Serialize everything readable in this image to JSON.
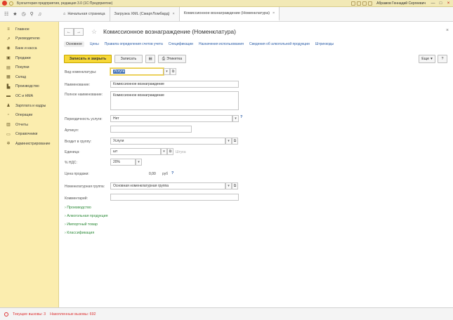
{
  "titlebar": {
    "title": "Бухгалтерия предприятия, редакция 3.0 (1С:Предприятие)",
    "user": "Абрамов Геннадий Сергеевич",
    "window_buttons": [
      "—",
      "□",
      "×"
    ]
  },
  "tabs": [
    {
      "label": "Начальная страница",
      "closable": false
    },
    {
      "label": "Загрузка XML (СмартЛомбард)",
      "closable": true
    },
    {
      "label": "Комиссионное вознаграждение (Номенклатура)",
      "closable": true
    }
  ],
  "sidebar": {
    "items": [
      {
        "label": "Главное",
        "icon": "menu-icon"
      },
      {
        "label": "Руководителю",
        "icon": "chart-icon"
      },
      {
        "label": "Банк и касса",
        "icon": "bank-icon"
      },
      {
        "label": "Продажи",
        "icon": "cart-icon"
      },
      {
        "label": "Покупки",
        "icon": "basket-icon"
      },
      {
        "label": "Склад",
        "icon": "warehouse-icon"
      },
      {
        "label": "Производство",
        "icon": "factory-icon"
      },
      {
        "label": "ОС и НМА",
        "icon": "truck-icon"
      },
      {
        "label": "Зарплата и кадры",
        "icon": "person-icon"
      },
      {
        "label": "Операции",
        "icon": "operations-icon"
      },
      {
        "label": "Отчеты",
        "icon": "report-icon"
      },
      {
        "label": "Справочники",
        "icon": "book-icon"
      },
      {
        "label": "Администрирование",
        "icon": "gear-icon"
      }
    ]
  },
  "document": {
    "title": "Комиссионное вознаграждение (Номенклатура)",
    "links": [
      "Основное",
      "Цены",
      "Правила определения счетов учета",
      "Спецификации",
      "Назначения использования",
      "Сведения об алкогольной продукции",
      "Штрихкоды"
    ]
  },
  "toolbar": {
    "save_close": "Записать и закрыть",
    "save": "Записать",
    "label_btn": "Этикетка",
    "more": "Еще",
    "help": "?"
  },
  "form": {
    "kind_label": "Вид номенклатуры:",
    "kind_value": "Услуги",
    "name_label": "Наименование:",
    "name_value": "Комиссионное вознаграждение",
    "fullname_label": "Полное наименование:",
    "fullname_value": "Комиссионное вознаграждение",
    "periodic_label": "Периодичность услуги:",
    "periodic_value": "Нет",
    "article_label": "Артикул:",
    "article_value": "",
    "group_label": "Входит в группу:",
    "group_value": "Услуги",
    "unit_label": "Единица:",
    "unit_value": "шт",
    "unit_note": "Штука",
    "vat_label": "% НДС:",
    "vat_value": "20%",
    "price_label": "Цена продажи:",
    "price_value": "0,00",
    "price_currency": "руб",
    "nomgroup_label": "Номенклатурная группа:",
    "nomgroup_value": "Основная номенклатурная группа",
    "comment_label": "Комментарий:",
    "comment_value": ""
  },
  "groups": [
    "Производство",
    "Алкогольная продукция",
    "Импортный товар",
    "Классификация"
  ],
  "status": {
    "current_calls": "Текущие вызовы: 3",
    "accumulated_calls": "Накопленные вызовы: 692"
  }
}
